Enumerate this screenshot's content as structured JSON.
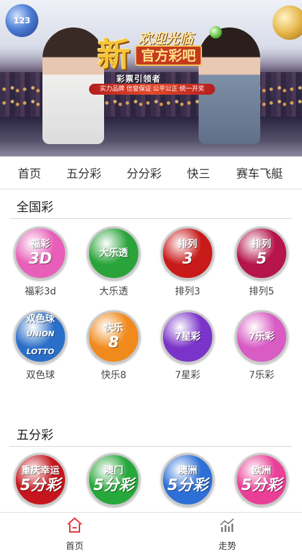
{
  "banner": {
    "ball_left_label": "123",
    "title_big": "新",
    "title_welcome": "欢迎光临",
    "title_sub": "官方彩吧",
    "slogan1": "彩票引领者",
    "slogan2": "实力品牌 信誉保证 公平公正 统一开奖"
  },
  "nav": {
    "items": [
      {
        "label": "首页"
      },
      {
        "label": "五分彩"
      },
      {
        "label": "分分彩"
      },
      {
        "label": "快三"
      },
      {
        "label": "赛车飞艇"
      }
    ]
  },
  "sections": [
    {
      "title": "全国彩",
      "items": [
        {
          "label": "福彩3d",
          "icon_top": "福彩",
          "icon_big": "3D",
          "color": "#e75fb8"
        },
        {
          "label": "大乐透",
          "icon_top": "大乐透",
          "icon_big": "",
          "color": "#2aa43a"
        },
        {
          "label": "排列3",
          "icon_top": "排列",
          "icon_big": "3",
          "color": "#c91a1a"
        },
        {
          "label": "排列5",
          "icon_top": "排列",
          "icon_big": "5",
          "color": "#b5154a"
        },
        {
          "label": "双色球",
          "icon_top": "双色球",
          "icon_big": "UNION LOTTO",
          "color": "#2a6fc7"
        },
        {
          "label": "快乐8",
          "icon_top": "快乐",
          "icon_big": "8",
          "color": "#f08a1c"
        },
        {
          "label": "7星彩",
          "icon_top": "7星彩",
          "icon_big": "",
          "color": "#7a34c9"
        },
        {
          "label": "7乐彩",
          "icon_top": "7乐彩",
          "icon_big": "",
          "color": "#d85cc4"
        }
      ]
    },
    {
      "title": "五分彩",
      "items": [
        {
          "label": "",
          "icon_top": "重庆幸运",
          "icon_big": "5分彩",
          "color": "#c5161d"
        },
        {
          "label": "",
          "icon_top": "澳门",
          "icon_big": "5分彩",
          "color": "#27a83a"
        },
        {
          "label": "",
          "icon_top": "澳洲",
          "icon_big": "5分彩",
          "color": "#2d6fd6"
        },
        {
          "label": "",
          "icon_top": "欧洲",
          "icon_big": "5分彩",
          "color": "#ea3f96"
        }
      ]
    }
  ],
  "bottom_tabs": {
    "home": {
      "label": "首页",
      "accent": "#e0343a"
    },
    "trend": {
      "label": "走势",
      "accent": "#666666"
    }
  }
}
